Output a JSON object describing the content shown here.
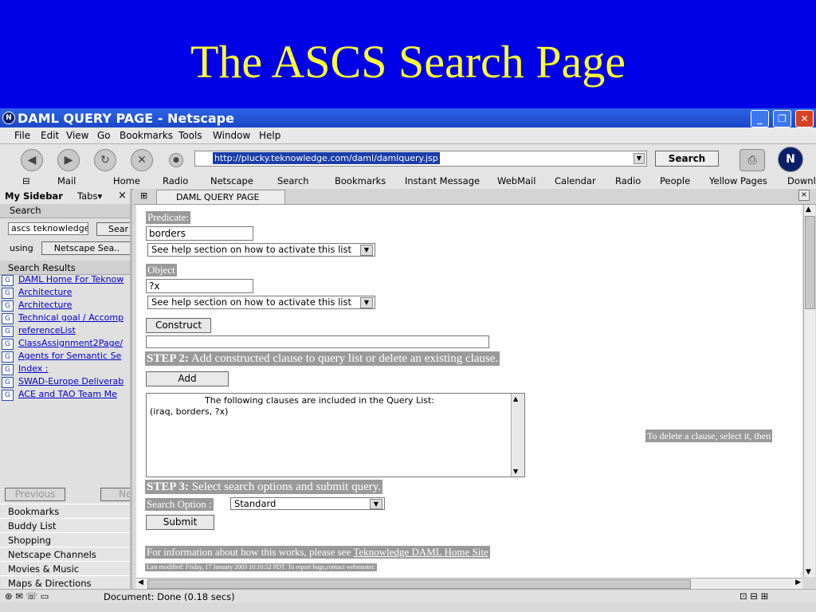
{
  "slide": {
    "title": "The ASCS Search Page"
  },
  "window": {
    "title": "DAML QUERY PAGE - Netscape",
    "controls": {
      "minimize": "_",
      "maximize": "❐",
      "close": "✕"
    }
  },
  "menu": [
    "File",
    "Edit",
    "View",
    "Go",
    "Bookmarks",
    "Tools",
    "Window",
    "Help"
  ],
  "nav": {
    "url": "http://plucky.teknowledge.com/daml/damlquery.jsp",
    "search_label": "Search"
  },
  "personal_toolbar": [
    "Mail",
    "Home",
    "Radio",
    "Netscape",
    "Search",
    "Bookmarks",
    "Instant Message",
    "WebMail",
    "Calendar",
    "Radio",
    "People",
    "Yellow Pages",
    "Downl"
  ],
  "sidebar": {
    "title": "My Sidebar",
    "tabs_label": "Tabs▾",
    "close": "×",
    "search_header": "Search",
    "query_value": "ascs teknowledge",
    "search_button": "Sear",
    "using_label": "using",
    "engine": "Netscape Sea..",
    "results_header": "Search Results",
    "results": [
      "DAML Home For Teknow",
      "Architecture",
      "Architecture",
      "Technical goal / Accomp",
      "referenceList",
      "ClassAssignment2Page/",
      "Agents for Semantic Se",
      "Index :",
      "SWAD-Europe Deliverab",
      "ACE and TAO Team Me"
    ],
    "previous_button": "Previous",
    "next_button": "Ne",
    "panels": [
      "Bookmarks",
      "Buddy List",
      "Shopping",
      "Netscape Channels",
      "Movies & Music",
      "Maps & Directions"
    ]
  },
  "tab": {
    "label": "DAML QUERY PAGE"
  },
  "page": {
    "predicate_label": "Predicate:",
    "predicate_value": "borders",
    "predicate_select": "See help section on how to activate this list",
    "object_label": "Object",
    "object_value": "?x",
    "object_select": "See help section on how to activate this list",
    "construct_button": "Construct",
    "step2_label": "STEP 2:",
    "step2_text": "Add constructed clause to query list or delete an existing clause.",
    "add_button": "Add",
    "clauses_heading": "The following clauses are included in the Query List:",
    "clause_item": "(iraq, borders, ?x)",
    "delete_hint": "To delete a clause, select it, then",
    "step3_label": "STEP 3:",
    "step3_text": "Select search options and submit query.",
    "search_option_label": "Search Option :",
    "search_option_value": "Standard",
    "submit_button": "Submit",
    "info_text": "For information about how this works, please see",
    "info_link": "Teknowledge DAML Home Site",
    "last_modified": "Last modified: Friday, 17 January 2003 10:10:52 PDT.  To report bugs,contact webmaster."
  },
  "status": {
    "text": "Document: Done (0.18 secs)"
  }
}
